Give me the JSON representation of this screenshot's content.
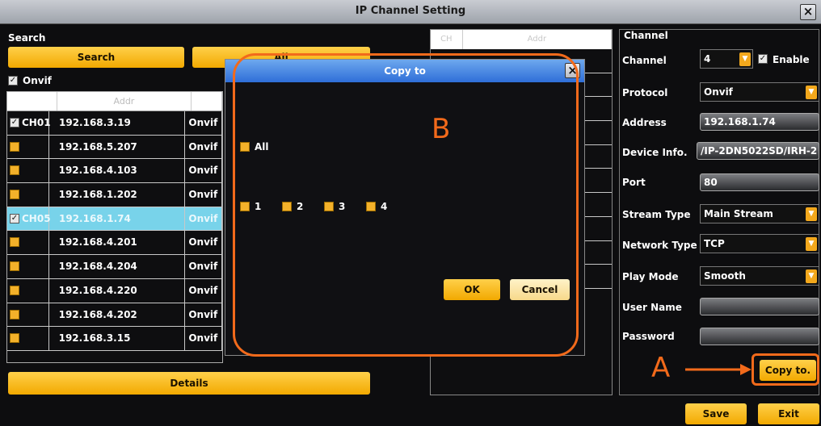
{
  "window": {
    "title": "IP Channel Setting",
    "close": "×"
  },
  "search": {
    "section_label": "Search",
    "search_button": "Search",
    "all_button": "All",
    "onvif_label": "Onvif",
    "onvif_checked": true,
    "col_addr": "Addr",
    "rows": [
      {
        "channel": "CH01",
        "checked": true,
        "ip": "192.168.3.19",
        "proto": "Onvif",
        "selected": false
      },
      {
        "channel": "",
        "checked": false,
        "ip": "192.168.5.207",
        "proto": "Onvif",
        "selected": false
      },
      {
        "channel": "",
        "checked": false,
        "ip": "192.168.4.103",
        "proto": "Onvif",
        "selected": false
      },
      {
        "channel": "",
        "checked": false,
        "ip": "192.168.1.202",
        "proto": "Onvif",
        "selected": false
      },
      {
        "channel": "CH05",
        "checked": true,
        "ip": "192.168.1.74",
        "proto": "Onvif",
        "selected": true
      },
      {
        "channel": "",
        "checked": false,
        "ip": "192.168.4.201",
        "proto": "Onvif",
        "selected": false
      },
      {
        "channel": "",
        "checked": false,
        "ip": "192.168.4.204",
        "proto": "Onvif",
        "selected": false
      },
      {
        "channel": "",
        "checked": false,
        "ip": "192.168.4.220",
        "proto": "Onvif",
        "selected": false
      },
      {
        "channel": "",
        "checked": false,
        "ip": "192.168.4.202",
        "proto": "Onvif",
        "selected": false
      },
      {
        "channel": "",
        "checked": false,
        "ip": "192.168.3.15",
        "proto": "Onvif",
        "selected": false
      }
    ],
    "details_button": "Details"
  },
  "middle": {
    "col1": "CH",
    "col2": "Addr"
  },
  "channel_panel": {
    "section_label": "Channel",
    "channel_label": "Channel",
    "channel_value": "4",
    "enable_label": "Enable",
    "enable_checked": true,
    "protocol_label": "Protocol",
    "protocol_value": "Onvif",
    "address_label": "Address",
    "address_value": "192.168.1.74",
    "device_info_label": "Device Info.",
    "device_info_value": "/IP-2DN5022SD/IRH-2",
    "port_label": "Port",
    "port_value": "80",
    "stream_type_label": "Stream Type",
    "stream_type_value": "Main Stream",
    "network_type_label": "Network Type",
    "network_type_value": "TCP",
    "play_mode_label": "Play Mode",
    "play_mode_value": "Smooth",
    "user_name_label": "User Name",
    "user_name_value": "",
    "password_label": "Password",
    "password_value": "",
    "copy_button": "Copy to.",
    "save_button": "Save",
    "exit_button": "Exit"
  },
  "dialog": {
    "title": "Copy to",
    "close": "×",
    "all_label": "All",
    "channels": [
      "1",
      "2",
      "3",
      "4"
    ],
    "ok_button": "OK",
    "cancel_button": "Cancel"
  },
  "annotations": {
    "label_a": "A",
    "label_b": "B",
    "color": "#f26a1b"
  },
  "colors": {
    "accent": "#f3a81c",
    "selected_row": "#78d3ea",
    "dialog_title": "#2f6ed8"
  }
}
